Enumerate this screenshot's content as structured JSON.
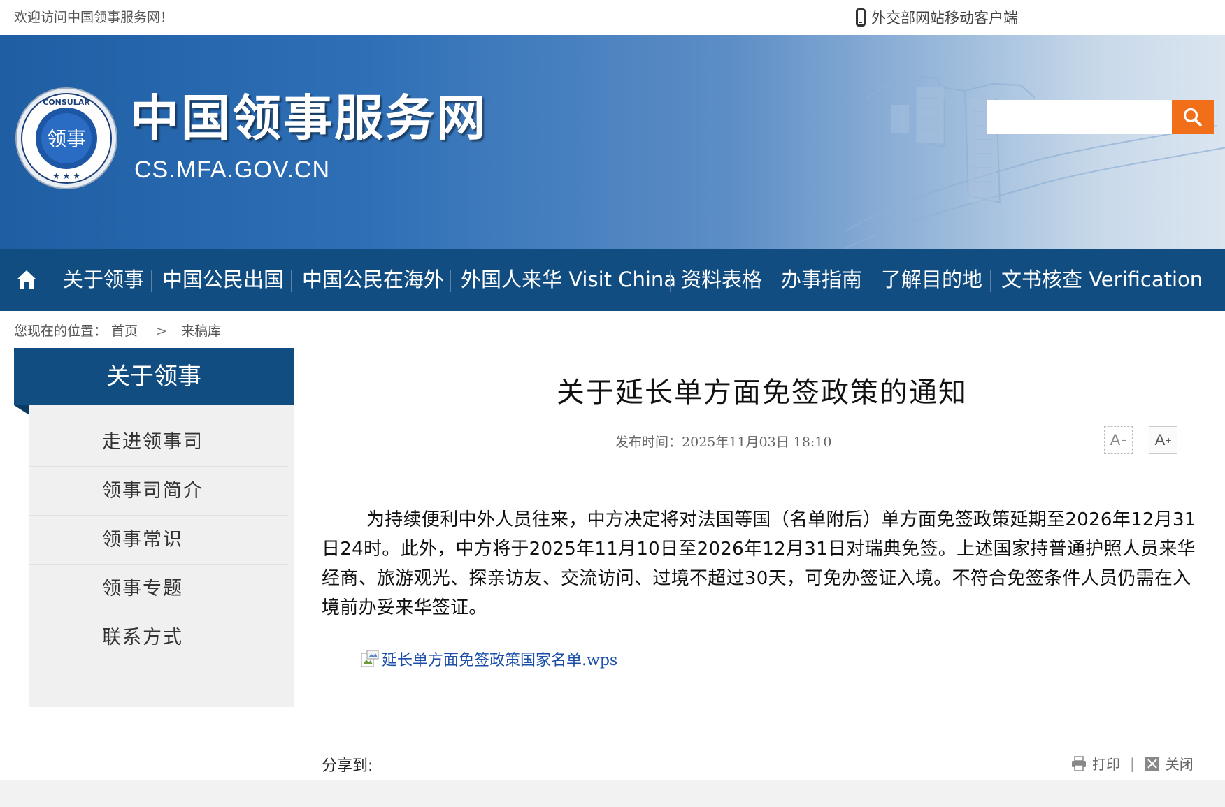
{
  "topbar": {
    "welcome": "欢迎访问中国领事服务网！",
    "mobile_link": "外交部网站移动客户端"
  },
  "header": {
    "title": "中国领事服务网",
    "domain": "CS.MFA.GOV.CN",
    "search_placeholder": ""
  },
  "nav": {
    "items": [
      {
        "label": "关于领事"
      },
      {
        "label": "中国公民出国"
      },
      {
        "label": "中国公民在海外"
      },
      {
        "label": "外国人来华 Visit China"
      },
      {
        "label": "资料表格"
      },
      {
        "label": "办事指南"
      },
      {
        "label": "了解目的地"
      },
      {
        "label": "文书核查 Verification"
      }
    ]
  },
  "breadcrumb": {
    "prefix": "您现在的位置：",
    "home": "首页",
    "separator": ">",
    "current": "来稿库"
  },
  "sidebar": {
    "title": "关于领事",
    "items": [
      {
        "label": "走进领事司"
      },
      {
        "label": "领事司简介"
      },
      {
        "label": "领事常识"
      },
      {
        "label": "领事专题"
      },
      {
        "label": "联系方式"
      }
    ]
  },
  "article": {
    "title": "关于延长单方面免签政策的通知",
    "publish_label": "发布时间：",
    "publish_time": "2025年11月03日  18:10",
    "font_small": "A",
    "font_big": "A",
    "body": "为持续便利中外人员往来，中方决定将对法国等国（名单附后）单方面免签政策延期至2026年12月31日24时。此外，中方将于2025年11月10日至2026年12月31日对瑞典免签。上述国家持普通护照人员来华经商、旅游观光、探亲访友、交流访问、过境不超过30天，可免办签证入境。不符合免签条件人员仍需在入境前办妥来华签证。",
    "attachment": "延长单方面免签政策国家名单.wps"
  },
  "footer_bar": {
    "share_label": "分享到:",
    "print_label": "打印",
    "divider": "|",
    "close_label": "关闭"
  },
  "colors": {
    "nav_bg": "#114d80",
    "search_btn": "#f26f1a",
    "link": "#1a4ea8"
  },
  "icons": {
    "home": "home-icon",
    "search": "search-icon",
    "phone": "phone-icon",
    "print": "printer-icon",
    "close": "close-icon"
  }
}
